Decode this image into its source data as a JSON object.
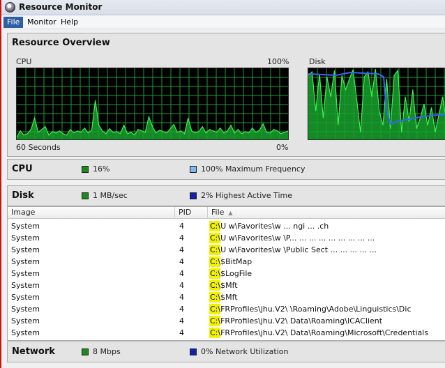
{
  "window": {
    "title": "Resource Monitor"
  },
  "menu": [
    {
      "label": "File",
      "active": true
    },
    {
      "label": "Monitor",
      "active": false
    },
    {
      "label": "Help",
      "active": false
    }
  ],
  "overview": {
    "title": "Resource Overview",
    "cpu_graph": {
      "label": "CPU",
      "max_label": "100%",
      "min_label": "0%",
      "time_label": "60 Seconds"
    },
    "disk_graph": {
      "label": "Disk"
    }
  },
  "cpu_section": {
    "title": "CPU",
    "usage": "16%",
    "usage_color": "#1a8a1a",
    "frequency": "100% Maximum Frequency",
    "frequency_color": "#7fb7ef"
  },
  "disk_section": {
    "title": "Disk",
    "rate": "1 MB/sec",
    "rate_color": "#1a8a1a",
    "active_time": "2% Highest Active Time",
    "active_color": "#1020b0"
  },
  "disk_table": {
    "columns": [
      "Image",
      "PID",
      "File"
    ],
    "rows": [
      {
        "image": "System",
        "pid": "4",
        "file": "C:\\U    w\\Favorites\\w         ...     ngi        ...     .ch"
      },
      {
        "image": "System",
        "pid": "4",
        "file": "C:\\U    w\\Favorites\\w  \\P...   ...   ...   ...    ...    ...   ...   ...   ..."
      },
      {
        "image": "System",
        "pid": "4",
        "file": "C:\\U    w\\Favorites\\w  \\Public Sect        ...   ...   ...   ...    ..."
      },
      {
        "image": "System",
        "pid": "4",
        "file": "C:\\$BitMap"
      },
      {
        "image": "System",
        "pid": "4",
        "file": "C:\\$LogFile"
      },
      {
        "image": "System",
        "pid": "4",
        "file": "C:\\$Mft"
      },
      {
        "image": "System",
        "pid": "4",
        "file": "C:\\$Mft"
      },
      {
        "image": "System",
        "pid": "4",
        "file": "C:\\FRProfiles\\jhu.V2\\         \\Roaming\\Adobe\\Linguistics\\Dic"
      },
      {
        "image": "System",
        "pid": "4",
        "file": "C:\\FRProfiles\\jhu.V2\\        Data\\Roaming\\ICAClient"
      },
      {
        "image": "System",
        "pid": "4",
        "file": "C:\\FRProfiles\\jhu.V2\\        Data\\Roaming\\Microsoft\\Credentials"
      }
    ]
  },
  "network_section": {
    "title": "Network",
    "rate": "8 Mbps",
    "rate_color": "#1a8a1a",
    "utilization": "0% Network Utilization",
    "utilization_color": "#1020b0"
  },
  "colors": {
    "graph_bg": "#000000",
    "graph_grid": "#1f9b3a",
    "graph_fill": "#17a12d",
    "graph_line": "#3ef24d",
    "disk_line": "#3a63ff",
    "highlight": "#f2f200"
  },
  "cpu_series": [
    3,
    12,
    6,
    8,
    14,
    30,
    10,
    14,
    18,
    6,
    11,
    9,
    12,
    8,
    6,
    14,
    9,
    12,
    10,
    16,
    9,
    13,
    55,
    20,
    12,
    8,
    15,
    10,
    11,
    8,
    20,
    8,
    10,
    6,
    14,
    12,
    10,
    32,
    18,
    9,
    13,
    11,
    9,
    15,
    21,
    10,
    12,
    8,
    30,
    12,
    9,
    11,
    18,
    9,
    14,
    12,
    10,
    16,
    9,
    12,
    20,
    9,
    14,
    8,
    11,
    9,
    16,
    10,
    13,
    22,
    10,
    9,
    14,
    12,
    8,
    10,
    12
  ],
  "disk_series": [
    90,
    95,
    40,
    92,
    30,
    88,
    60,
    97,
    20,
    90,
    70,
    85,
    98,
    55,
    10,
    88,
    95,
    60,
    99,
    40,
    20,
    85,
    15,
    90,
    97,
    10,
    60,
    25,
    70,
    15,
    30,
    50,
    20,
    45,
    10,
    35,
    60,
    25
  ]
}
